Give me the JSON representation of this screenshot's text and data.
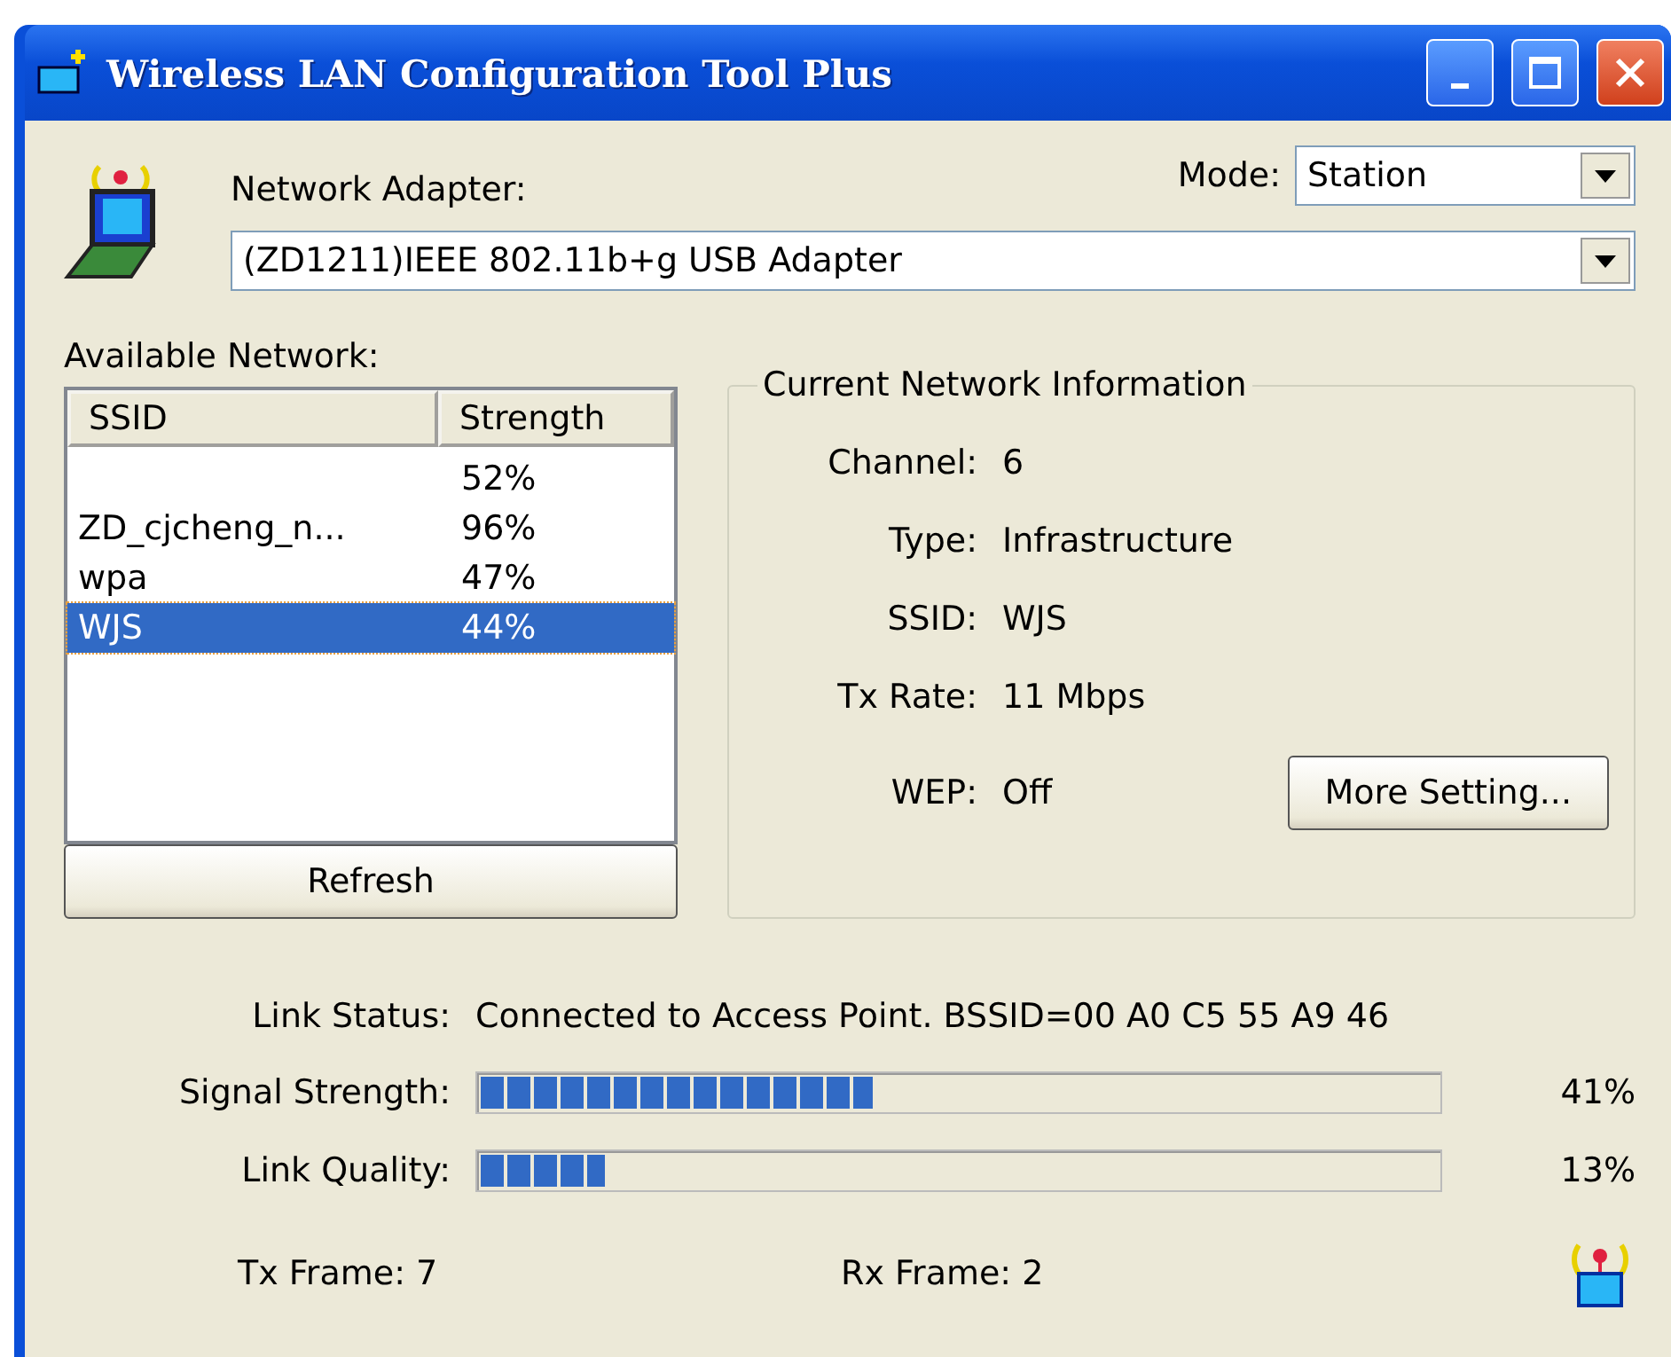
{
  "window": {
    "title": "Wireless LAN Configuration Tool Plus"
  },
  "adapter": {
    "label": "Network Adapter:",
    "value": "(ZD1211)IEEE 802.11b+g USB Adapter"
  },
  "mode": {
    "label": "Mode:",
    "value": "Station"
  },
  "available_network": {
    "label": "Available Network:",
    "columns": [
      "SSID",
      "Strength"
    ],
    "rows": [
      {
        "strength": "52%",
        "selected": false
      },
      {
        "ssid": "ZD_cjcheng_n...",
        "strength": "96%",
        "selected": false
      },
      {
        "ssid": "wpa",
        "strength": "47%",
        "selected": false
      },
      {
        "ssid": "WJS",
        "strength": "44%",
        "selected": true
      }
    ],
    "refresh_button": "Refresh"
  },
  "current_network": {
    "title": "Current Network Information",
    "fields": [
      {
        "label": "Channel:",
        "value": "6"
      },
      {
        "label": "Type:",
        "value": "Infrastructure"
      },
      {
        "label": "SSID:",
        "value": "WJS"
      },
      {
        "label": "Tx Rate:",
        "value": "11 Mbps"
      },
      {
        "label": "WEP:",
        "value": "Off"
      }
    ],
    "more_button": "More Setting..."
  },
  "link_status": {
    "label": "Link Status:",
    "value": "Connected to Access Point. BSSID=00 A0 C5 55 A9 46"
  },
  "meters": [
    {
      "label": "Signal Strength:",
      "level": 0.41,
      "reading": "41%"
    },
    {
      "label": "Link Quality:",
      "level": 0.13,
      "reading": "13%"
    }
  ],
  "frames": [
    {
      "label": "Tx Frame:",
      "value": "7"
    },
    {
      "label": "Rx Frame:",
      "value": "2"
    }
  ]
}
